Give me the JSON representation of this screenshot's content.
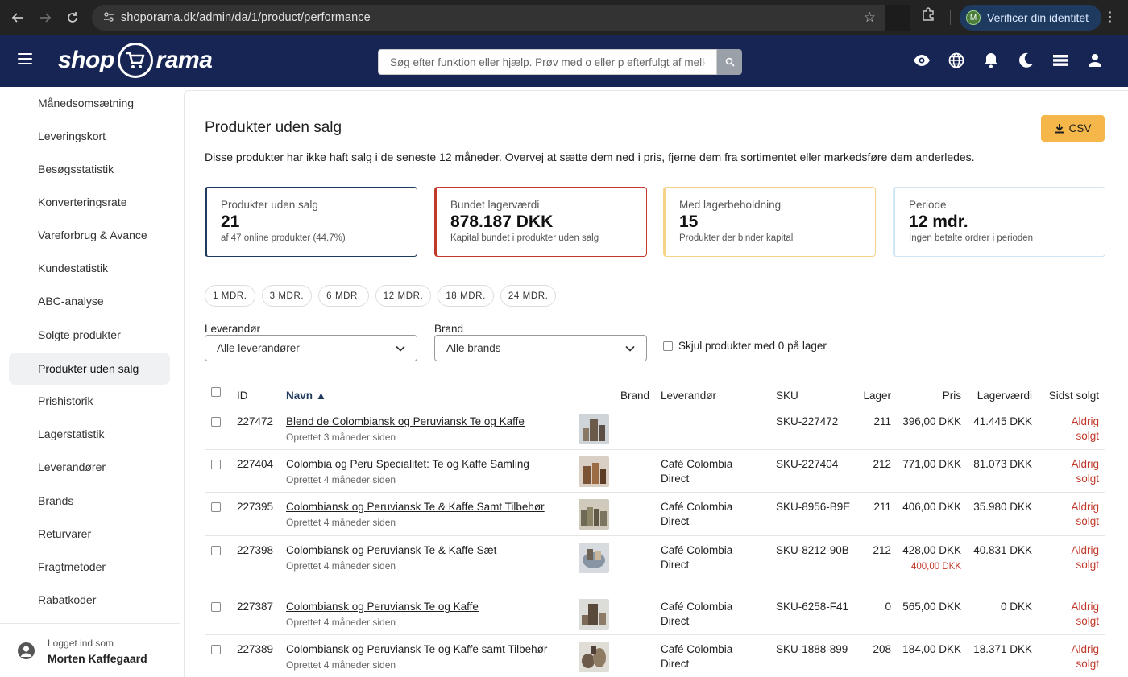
{
  "browser": {
    "url": "shoporama.dk/admin/da/1/product/performance",
    "verify_label": "Verificer din identitet",
    "verify_initial": "M"
  },
  "header": {
    "logo_left": "shop",
    "logo_right": "rama",
    "search_placeholder": "Søg efter funktion eller hjælp. Prøv med o eller p efterfulgt af mellemrum",
    "icons": [
      "eye-icon",
      "globe-icon",
      "bell-icon",
      "moon-icon",
      "stack-icon",
      "user-icon"
    ]
  },
  "sidebar": {
    "items": [
      {
        "label": "Månedsomsætning",
        "active": false
      },
      {
        "label": "Leveringskort",
        "active": false
      },
      {
        "label": "Besøgsstatistik",
        "active": false
      },
      {
        "label": "Konverteringsrate",
        "active": false
      },
      {
        "label": "Vareforbrug & Avance",
        "active": false
      },
      {
        "label": "Kundestatistik",
        "active": false
      },
      {
        "label": "ABC-analyse",
        "active": false
      },
      {
        "label": "Solgte produkter",
        "active": false
      },
      {
        "label": "Produkter uden salg",
        "active": true
      },
      {
        "label": "Prishistorik",
        "active": false
      },
      {
        "label": "Lagerstatistik",
        "active": false
      },
      {
        "label": "Leverandører",
        "active": false
      },
      {
        "label": "Brands",
        "active": false
      },
      {
        "label": "Returvarer",
        "active": false
      },
      {
        "label": "Fragtmetoder",
        "active": false
      },
      {
        "label": "Rabatkoder",
        "active": false
      }
    ],
    "footer": {
      "logged_in_as": "Logget ind som",
      "user_name": "Morten Kaffegaard"
    }
  },
  "main": {
    "title": "Produkter uden salg",
    "csv_label": "CSV",
    "description": "Disse produkter har ikke haft salg i de seneste 12 måneder. Overvej at sætte dem ned i pris, fjerne dem fra sortimentet eller markedsføre dem anderledes.",
    "stats": [
      {
        "label": "Produkter uden salg",
        "value": "21",
        "sub": "af 47 online produkter (44.7%)"
      },
      {
        "label": "Bundet lagerværdi",
        "value": "878.187 DKK",
        "sub": "Kapital bundet i produkter uden salg"
      },
      {
        "label": "Med lagerbeholdning",
        "value": "15",
        "sub": "Produkter der binder kapital"
      },
      {
        "label": "Periode",
        "value": "12 mdr.",
        "sub": "Ingen betalte ordrer i perioden"
      }
    ],
    "periods": [
      "1 MDR.",
      "3 MDR.",
      "6 MDR.",
      "12 MDR.",
      "18 MDR.",
      "24 MDR."
    ],
    "filters": {
      "supplier_label": "Leverandør",
      "supplier_value": "Alle leverandører",
      "brand_label": "Brand",
      "brand_value": "Alle brands",
      "hide_zero_label": "Skjul produkter med 0 på lager"
    },
    "table": {
      "headers": {
        "id": "ID",
        "name": "Navn ▲",
        "brand": "Brand",
        "supplier": "Leverandør",
        "sku": "SKU",
        "stock": "Lager",
        "price": "Pris",
        "stock_value": "Lagerværdi",
        "last_sold": "Sidst solgt"
      },
      "rows": [
        {
          "id": "227472",
          "name": "Blend de Colombiansk og Peruviansk Te og Kaffe",
          "created": "Oprettet 3 måneder siden",
          "brand": "",
          "supplier": "",
          "sku": "SKU-227472",
          "stock": "211",
          "price": "396,00 DKK",
          "old_price": "",
          "stock_value": "41.445 DKK",
          "last_sold": "Aldrig solgt"
        },
        {
          "id": "227404",
          "name": "Colombia og Peru Specialitet: Te og Kaffe Samling",
          "created": "Oprettet 4 måneder siden",
          "brand": "",
          "supplier": "Café Colombia Direct",
          "sku": "SKU-227404",
          "stock": "212",
          "price": "771,00 DKK",
          "old_price": "",
          "stock_value": "81.073 DKK",
          "last_sold": "Aldrig solgt"
        },
        {
          "id": "227395",
          "name": "Colombiansk og Peruviansk Te & Kaffe Samt Tilbehør",
          "created": "Oprettet 4 måneder siden",
          "brand": "",
          "supplier": "Café Colombia Direct",
          "sku": "SKU-8956-B9E",
          "stock": "211",
          "price": "406,00 DKK",
          "old_price": "",
          "stock_value": "35.980 DKK",
          "last_sold": "Aldrig solgt"
        },
        {
          "id": "227398",
          "name": "Colombiansk og Peruviansk Te & Kaffe Sæt",
          "created": "Oprettet 4 måneder siden",
          "brand": "",
          "supplier": "Café Colombia Direct",
          "sku": "SKU-8212-90B",
          "stock": "212",
          "price": "428,00 DKK",
          "old_price": "400,00 DKK",
          "stock_value": "40.831 DKK",
          "last_sold": "Aldrig solgt"
        },
        {
          "id": "227387",
          "name": "Colombiansk og Peruviansk Te og Kaffe",
          "created": "Oprettet 4 måneder siden",
          "brand": "",
          "supplier": "Café Colombia Direct",
          "sku": "SKU-6258-F41",
          "stock": "0",
          "price": "565,00 DKK",
          "old_price": "",
          "stock_value": "0 DKK",
          "last_sold": "Aldrig solgt"
        },
        {
          "id": "227389",
          "name": "Colombiansk og Peruviansk Te og Kaffe samt Tilbehør",
          "created": "Oprettet 4 måneder siden",
          "brand": "",
          "supplier": "Café Colombia Direct",
          "sku": "SKU-1888-899",
          "stock": "208",
          "price": "184,00 DKK",
          "old_price": "",
          "stock_value": "18.371 DKK",
          "last_sold": "Aldrig solgt"
        }
      ]
    }
  },
  "colors": {
    "header_bg": "#172554",
    "accent_csv": "#f6b74a",
    "danger": "#c0392b"
  }
}
